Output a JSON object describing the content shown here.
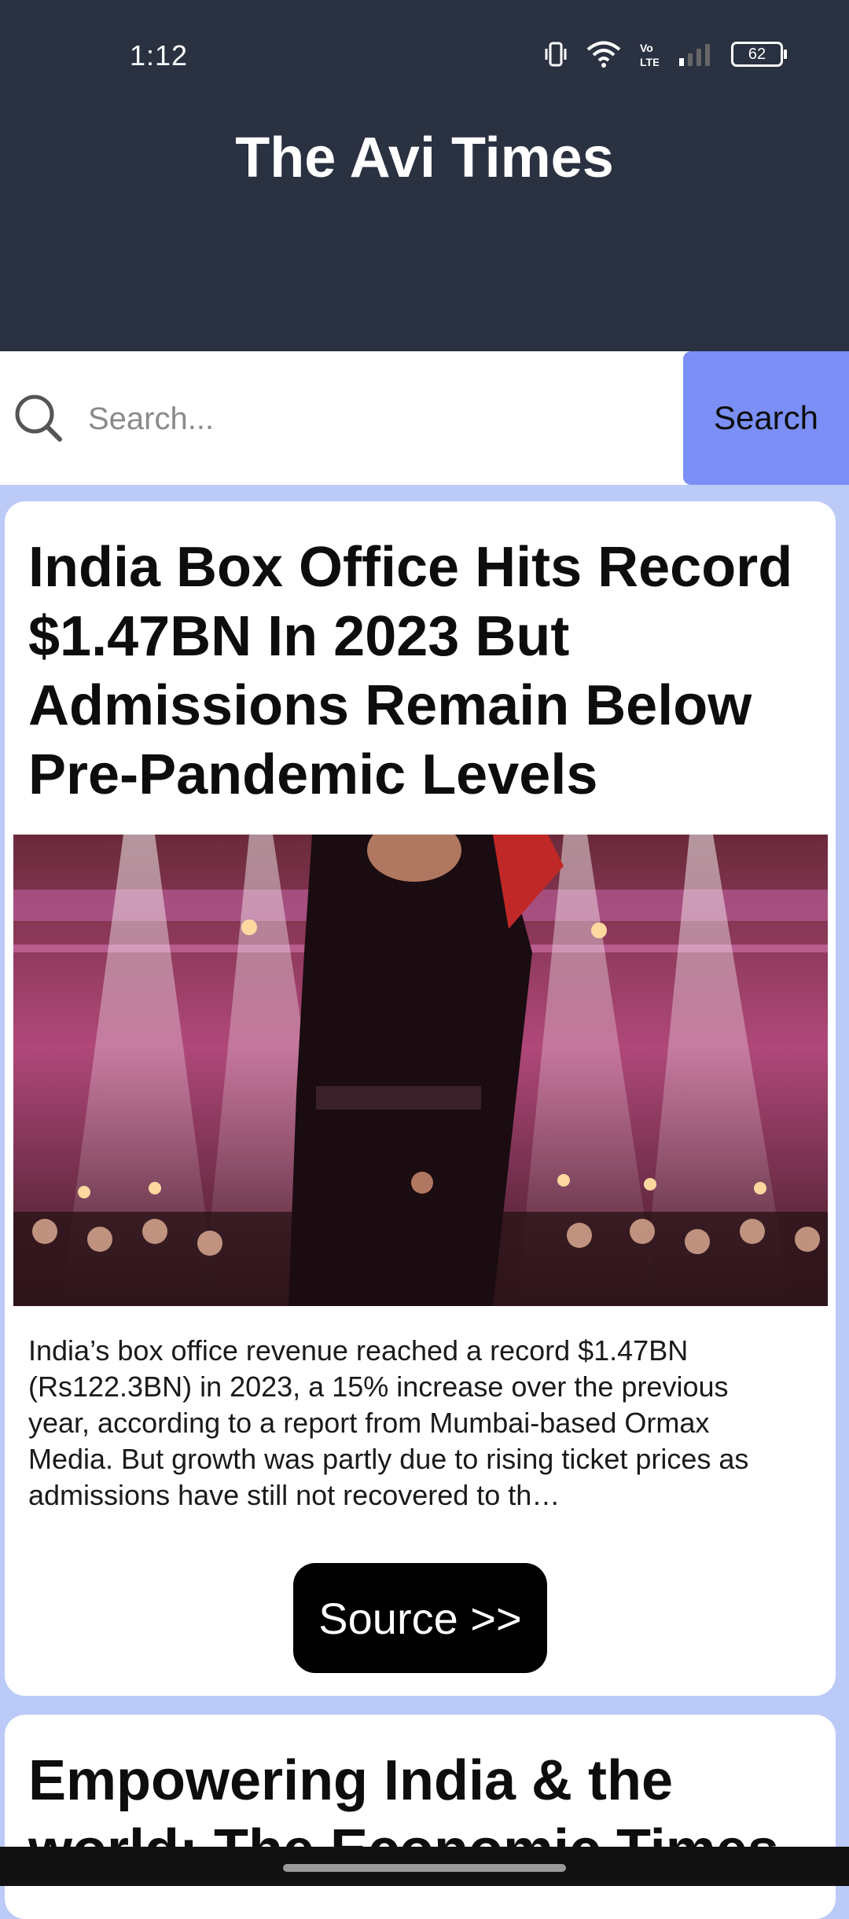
{
  "status_bar": {
    "time": "1:12",
    "battery": "62",
    "icons": [
      "vibrate-icon",
      "wifi-icon",
      "volte-icon",
      "signal-icon",
      "battery-icon"
    ]
  },
  "header": {
    "title": "The Avi Times"
  },
  "search": {
    "placeholder": "Search...",
    "value": "",
    "button_label": "Search"
  },
  "articles": [
    {
      "title": "India Box Office Hits Record $1.47BN In 2023 But Admissions Remain Below Pre-Pandemic Levels",
      "description": "India’s box office revenue reached a record $1.47BN (Rs122.3BN) in 2023, a 15% increase over the previous year, according to a report from Mumbai-based Ormax Media. But growth was partly due to rising ticket prices as admissions have still not recovered to th…",
      "source_label": "Source >>"
    },
    {
      "title": "Empowering India & the world: The Economic Times"
    }
  ],
  "colors": {
    "header_bg": "#2a3140",
    "page_bg": "#bccaf8",
    "search_button": "#7b8ff6",
    "source_button": "#000000"
  }
}
